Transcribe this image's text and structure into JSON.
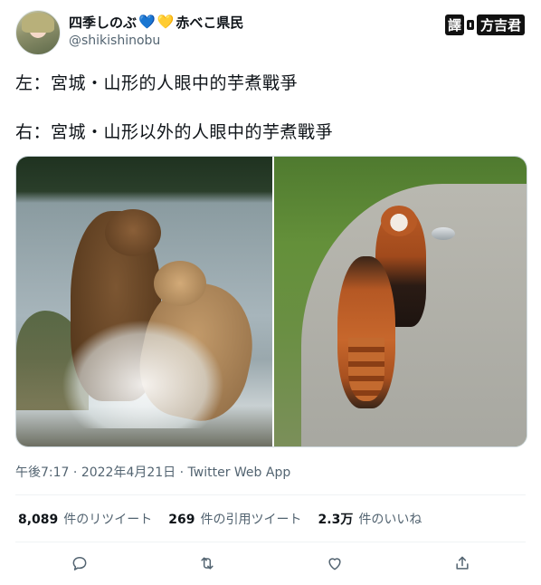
{
  "author": {
    "display_name": "四季しのぶ",
    "hearts": [
      "💙",
      "💛"
    ],
    "name_suffix": "赤べこ県民",
    "handle": "@shikishinobu"
  },
  "translator_badge": {
    "part1": "譯",
    "part2": "方吉君"
  },
  "tweet": {
    "line1": "左：宮城・山形的人眼中的芋煮戰爭",
    "line2": "右：宮城・山形以外的人眼中的芋煮戰爭"
  },
  "media": {
    "left_image": "bears-fighting-in-water",
    "right_image": "red-pandas-standing"
  },
  "meta": {
    "time": "午後7:17",
    "separator": "·",
    "date": "2022年4月21日",
    "client": "Twitter Web App"
  },
  "stats": [
    {
      "num": "8,089",
      "label": "件のリツイート"
    },
    {
      "num": "269",
      "label": "件の引用ツイート"
    },
    {
      "num": "2.3万",
      "label": "件のいいね"
    }
  ],
  "actions": [
    "reply-icon",
    "retweet-icon",
    "like-icon",
    "share-icon"
  ],
  "colors": {
    "secondary_text": "#536471",
    "divider": "#eff3f4"
  }
}
